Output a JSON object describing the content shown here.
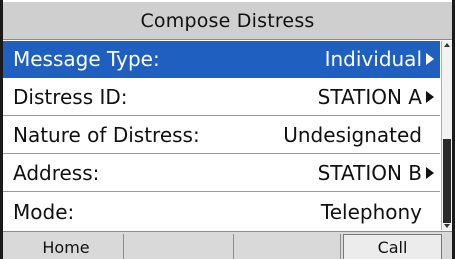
{
  "title": "Compose Distress",
  "menu": {
    "items": [
      {
        "label": "Message Type:",
        "value": "Individual",
        "has_arrow": true,
        "selected": true
      },
      {
        "label": "Distress ID:",
        "value": "STATION A",
        "has_arrow": true,
        "selected": false
      },
      {
        "label": "Nature of Distress:",
        "value": "Undesignated",
        "has_arrow": false,
        "selected": false
      },
      {
        "label": "Address:",
        "value": "STATION B",
        "has_arrow": true,
        "selected": false
      },
      {
        "label": "Mode:",
        "value": "Telephony",
        "has_arrow": false,
        "selected": false
      }
    ]
  },
  "softkeys": [
    "Home",
    "",
    "",
    "Call"
  ],
  "colors": {
    "selection": "#1f5fbf",
    "title_bg": "#cfcfcf",
    "softkey_bg": "#d9d9d9"
  }
}
